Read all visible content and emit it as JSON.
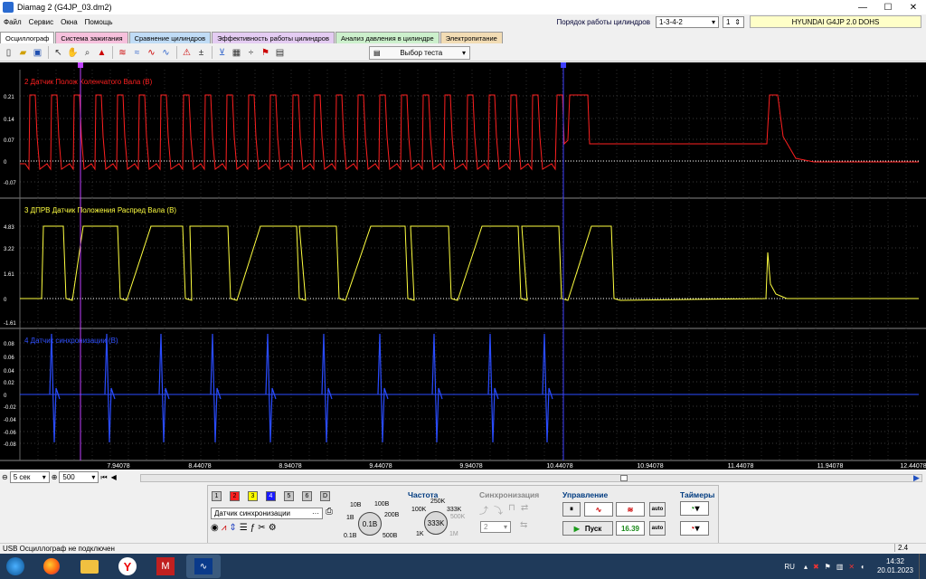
{
  "window": {
    "title": "Diamag 2 (G4JP_03.dm2)"
  },
  "menu": [
    "Файл",
    "Сервис",
    "Окна",
    "Помощь"
  ],
  "header": {
    "firing_order_label": "Порядок работы цилиндров",
    "firing_order_value": "1-3-4-2",
    "cylinder_value": "1",
    "car_name": "HYUNDAI G4JP 2.0 DOHS"
  },
  "tabs": [
    {
      "label": "Осциллограф",
      "color": "#ffffff"
    },
    {
      "label": "Система зажигания",
      "color": "#f2b8d8"
    },
    {
      "label": "Сравнение цилиндров",
      "color": "#b8d8f2"
    },
    {
      "label": "Эффективность работы цилиндров",
      "color": "#e0c8f0"
    },
    {
      "label": "Анализ давления в цилиндре",
      "color": "#c8f0c8"
    },
    {
      "label": "Электропитание",
      "color": "#f0d8b0"
    }
  ],
  "toolbar": {
    "test_select": "Выбор теста"
  },
  "channels": [
    {
      "title": "2 Датчик Полож Коленчатого Вала (В)",
      "color": "#ff2020",
      "ticks": [
        "0.21",
        "0.14",
        "0.07",
        "0",
        "-0.07"
      ]
    },
    {
      "title": "3 ДПРВ Датчик Положения Распред Вала (В)",
      "color": "#ffff40",
      "ticks": [
        "4.83",
        "3.22",
        "1.61",
        "0",
        "-1.61"
      ]
    },
    {
      "title": "4 Датчик синхронизации (В)",
      "color": "#3050ff",
      "ticks": [
        "0.08",
        "0.06",
        "0.04",
        "0.02",
        "0",
        "-0.02",
        "-0.04",
        "-0.06",
        "-0.08"
      ]
    }
  ],
  "xaxis": {
    "ticks": [
      "7.94078",
      "8.44078",
      "8.94078",
      "9.44078",
      "9.94078",
      "10.44078",
      "10.94078",
      "11.44078",
      "11.94078",
      "12.44078"
    ]
  },
  "timebase": {
    "sec_value": "5 сек",
    "points_value": "500"
  },
  "channel_buttons": [
    "1",
    "2",
    "3",
    "4",
    "5",
    "6",
    "D"
  ],
  "controls": {
    "channel_select": "Датчик синхронизации",
    "volt_knob": "0.1В",
    "volt_labels": [
      "10В",
      "100В",
      "200В",
      "1В",
      "0.1В",
      "500В"
    ],
    "freq_title": "Частота",
    "freq_knob": "333K",
    "freq_labels": [
      "250K",
      "100K",
      "333K",
      "500K",
      "1K",
      "1M"
    ],
    "sync_title": "Синхронизация",
    "sync_value": "2",
    "control_title": "Управление",
    "start_label": "Пуск",
    "counter_value": "16.39",
    "timers_title": "Таймеры",
    "auto1": "auto",
    "auto2": "auto"
  },
  "status": {
    "left": "USB Осциллограф не подключен",
    "right": "2.4"
  },
  "taskbar": {
    "lang": "RU",
    "time": "14:32",
    "date": "20.01.2023"
  }
}
